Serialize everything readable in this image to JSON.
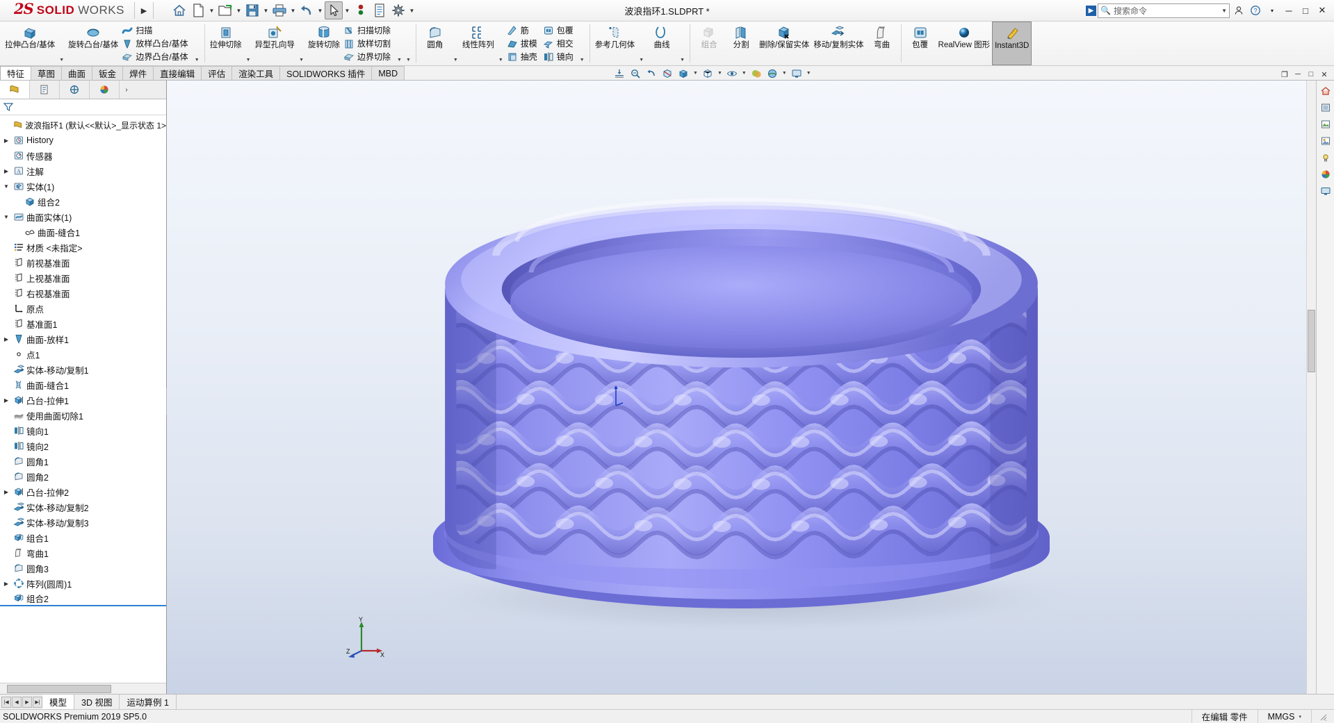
{
  "titlebar": {
    "brand_ds": "2S",
    "brand_solid": "SOLID",
    "brand_works": "WORKS",
    "expand_arrow": "▶",
    "document_title": "波浪指环1.SLDPRT *",
    "quick_access": [
      {
        "name": "home-icon",
        "label": "主页",
        "caret": false
      },
      {
        "name": "new-document-icon",
        "label": "新建",
        "caret": true
      },
      {
        "name": "open-folder-icon",
        "label": "打开",
        "caret": true
      },
      {
        "name": "save-icon",
        "label": "保存",
        "caret": true
      },
      {
        "name": "print-icon",
        "label": "打印",
        "caret": true
      },
      {
        "name": "undo-icon",
        "label": "撤销",
        "caret": true
      },
      {
        "name": "select-cursor-icon",
        "label": "选择",
        "caret": true
      },
      {
        "name": "rebuild-icon",
        "label": "重建模型",
        "caret": false
      },
      {
        "name": "file-properties-icon",
        "label": "文件属性",
        "caret": false
      },
      {
        "name": "options-gear-icon",
        "label": "选项",
        "caret": true
      }
    ],
    "search": {
      "placeholder": "搜索命令",
      "icon": "search-icon",
      "dropdown": "▼"
    },
    "help_icon": "help-icon",
    "account_icon": "account-icon",
    "help_caret": "▾",
    "window_buttons": {
      "minimize": "─",
      "maximize": "□",
      "close": "✕"
    }
  },
  "ribbon": {
    "groups": [
      {
        "id": "features-boss",
        "big": [
          {
            "name": "extruded-boss-base",
            "label": "拉伸凸台/基体",
            "icon": "extrude-boss-icon",
            "caret": true
          },
          {
            "name": "revolved-boss-base",
            "label": "旋转凸台/基体",
            "icon": "revolve-boss-icon",
            "caret": false
          }
        ],
        "small": [
          {
            "name": "swept-boss-base",
            "label": "扫描",
            "icon": "sweep-icon"
          },
          {
            "name": "lofted-boss-base",
            "label": "放样凸台/基体",
            "icon": "loft-icon"
          },
          {
            "name": "boundary-boss-base",
            "label": "边界凸台/基体",
            "icon": "boundary-icon"
          }
        ]
      },
      {
        "id": "features-cut",
        "big": [
          {
            "name": "extruded-cut",
            "label": "拉伸切除",
            "icon": "extrude-cut-icon",
            "caret": true
          },
          {
            "name": "hole-wizard",
            "label": "异型孔向导",
            "icon": "hole-wizard-icon",
            "caret": true
          },
          {
            "name": "revolved-cut",
            "label": "旋转切除",
            "icon": "revolve-cut-icon",
            "caret": false
          }
        ],
        "small": [
          {
            "name": "swept-cut",
            "label": "扫描切除",
            "icon": "sweep-cut-icon"
          },
          {
            "name": "lofted-cut",
            "label": "放样切割",
            "icon": "loft-cut-icon"
          },
          {
            "name": "boundary-cut",
            "label": "边界切除",
            "icon": "boundary-cut-icon"
          }
        ]
      },
      {
        "id": "features-modify",
        "big": [
          {
            "name": "fillet",
            "label": "圆角",
            "icon": "fillet-icon",
            "caret": true
          },
          {
            "name": "linear-pattern",
            "label": "线性阵列",
            "icon": "linear-pattern-icon",
            "caret": true
          }
        ],
        "small": [
          {
            "name": "rib",
            "label": "筋",
            "icon": "rib-icon"
          },
          {
            "name": "draft",
            "label": "拔模",
            "icon": "draft-icon"
          },
          {
            "name": "shell",
            "label": "抽壳",
            "icon": "shell-icon"
          }
        ],
        "small2": [
          {
            "name": "wrap",
            "label": "包覆",
            "icon": "wrap-icon"
          },
          {
            "name": "intersect",
            "label": "相交",
            "icon": "intersect-icon"
          },
          {
            "name": "mirror",
            "label": "镜向",
            "icon": "mirror-icon"
          }
        ]
      },
      {
        "id": "reference",
        "big": [
          {
            "name": "reference-geometry",
            "label": "参考几何体",
            "icon": "reference-geometry-icon",
            "caret": true
          },
          {
            "name": "curves",
            "label": "曲线",
            "icon": "curve-icon",
            "caret": true
          }
        ]
      },
      {
        "id": "bodies",
        "big": [
          {
            "name": "combine",
            "label": "组合",
            "icon": "combine-icon",
            "disabled": true
          },
          {
            "name": "split",
            "label": "分割",
            "icon": "split-icon"
          },
          {
            "name": "delete-keep-body",
            "label": "删除/保留实体",
            "icon": "delete-body-icon"
          },
          {
            "name": "move-copy-body",
            "label": "移动/复制实体",
            "icon": "move-copy-icon"
          },
          {
            "name": "flex",
            "label": "弯曲",
            "icon": "flex-icon"
          }
        ]
      },
      {
        "id": "display",
        "big": [
          {
            "name": "wrap-2",
            "label": "包覆",
            "icon": "wrap-icon"
          },
          {
            "name": "realview-graphics",
            "label": "RealView 图形",
            "icon": "realview-icon"
          },
          {
            "name": "instant3d",
            "label": "Instant3D",
            "icon": "instant3d-icon",
            "active": true
          }
        ]
      }
    ]
  },
  "command_tabs": {
    "items": [
      {
        "name": "tab-features",
        "label": "特征",
        "selected": true
      },
      {
        "name": "tab-sketch",
        "label": "草图",
        "selected": false
      },
      {
        "name": "tab-surfaces",
        "label": "曲面",
        "selected": false
      },
      {
        "name": "tab-sheetmetal",
        "label": "钣金",
        "selected": false
      },
      {
        "name": "tab-weldments",
        "label": "焊件",
        "selected": false
      },
      {
        "name": "tab-direct-editing",
        "label": "直接编辑",
        "selected": false
      },
      {
        "name": "tab-evaluate",
        "label": "评估",
        "selected": false
      },
      {
        "name": "tab-render-tools",
        "label": "渲染工具",
        "selected": false
      },
      {
        "name": "tab-sw-addins",
        "label": "SOLIDWORKS 插件",
        "selected": false
      },
      {
        "name": "tab-mbd",
        "label": "MBD",
        "selected": false
      }
    ],
    "window_controls": {
      "restore": "❐",
      "minimize": "─",
      "maximize": "□",
      "close": "✕"
    }
  },
  "heads_up_view": [
    {
      "name": "zoom-to-fit-icon",
      "label": "整屏显示全图",
      "caret": false
    },
    {
      "name": "zoom-to-area-icon",
      "label": "局部放大",
      "caret": false
    },
    {
      "name": "previous-view-icon",
      "label": "上一视图",
      "caret": false
    },
    {
      "name": "section-view-icon",
      "label": "剖面视图",
      "caret": false
    },
    {
      "name": "view-orientation-icon",
      "label": "视向",
      "caret": false
    },
    {
      "name": "display-style-icon",
      "label": "显示样式",
      "caret": true
    },
    {
      "name": "hide-show-items-icon",
      "label": "隐藏/显示项目",
      "caret": true
    },
    {
      "name": "edit-appearance-icon",
      "label": "编辑外观",
      "caret": false
    },
    {
      "name": "apply-scene-icon",
      "label": "应用布景",
      "caret": true
    },
    {
      "name": "view-settings-icon",
      "label": "视图设定",
      "caret": true
    }
  ],
  "feature_manager": {
    "tabs": [
      {
        "name": "featuremanager-design-tree-tab",
        "icon": "tree-icon",
        "selected": true
      },
      {
        "name": "property-manager-tab",
        "icon": "property-icon",
        "selected": false
      },
      {
        "name": "configuration-manager-tab",
        "icon": "config-icon",
        "selected": false
      },
      {
        "name": "display-manager-tab",
        "icon": "display-manager-icon",
        "selected": false
      }
    ],
    "more_tabs": "›",
    "filter_placeholder": "",
    "filter_value": "",
    "root": {
      "name": "tree-root-part",
      "icon": "part-icon",
      "label": "波浪指环1  (默认<<默认>_显示状态 1>"
    },
    "items": [
      {
        "name": "tree-item-history",
        "label": "History",
        "icon": "history-icon",
        "twist": "right",
        "indent": 0
      },
      {
        "name": "tree-item-sensors",
        "label": "传感器",
        "icon": "sensor-icon",
        "twist": "none",
        "indent": 0
      },
      {
        "name": "tree-item-annotations",
        "label": "注解",
        "icon": "annotation-icon",
        "twist": "right",
        "indent": 0
      },
      {
        "name": "tree-item-solid-bodies",
        "label": "实体(1)",
        "icon": "solid-bodies-icon",
        "twist": "down",
        "indent": 0
      },
      {
        "name": "tree-item-combine2-body",
        "label": "组合2",
        "icon": "body-cube-icon",
        "twist": "none",
        "indent": 1
      },
      {
        "name": "tree-item-surface-bodies",
        "label": "曲面实体(1)",
        "icon": "surface-bodies-icon",
        "twist": "down",
        "indent": 0
      },
      {
        "name": "tree-item-surface-knit1-body",
        "label": "曲面-缝合1",
        "icon": "surface-body-icon",
        "twist": "none",
        "indent": 1
      },
      {
        "name": "tree-item-material",
        "label": "材质 <未指定>",
        "icon": "material-icon",
        "twist": "none",
        "indent": 0
      },
      {
        "name": "tree-item-front-plane",
        "label": "前视基准面",
        "icon": "plane-icon",
        "twist": "none",
        "indent": 0
      },
      {
        "name": "tree-item-top-plane",
        "label": "上视基准面",
        "icon": "plane-icon",
        "twist": "none",
        "indent": 0
      },
      {
        "name": "tree-item-right-plane",
        "label": "右视基准面",
        "icon": "plane-icon",
        "twist": "none",
        "indent": 0
      },
      {
        "name": "tree-item-origin",
        "label": "原点",
        "icon": "origin-icon",
        "twist": "none",
        "indent": 0
      },
      {
        "name": "tree-item-plane1",
        "label": "基准面1",
        "icon": "plane-icon",
        "twist": "none",
        "indent": 0
      },
      {
        "name": "tree-item-surface-loft1",
        "label": "曲面-放样1",
        "icon": "surface-loft-icon",
        "twist": "right",
        "indent": 0
      },
      {
        "name": "tree-item-point1",
        "label": "点1",
        "icon": "point-icon",
        "twist": "none",
        "indent": 0
      },
      {
        "name": "tree-item-body-move-copy1",
        "label": "实体-移动/复制1",
        "icon": "move-copy-icon",
        "twist": "none",
        "indent": 0
      },
      {
        "name": "tree-item-surface-knit1",
        "label": "曲面-缝合1",
        "icon": "knit-icon",
        "twist": "none",
        "indent": 0
      },
      {
        "name": "tree-item-boss-extrude1",
        "label": "凸台-拉伸1",
        "icon": "boss-extrude-icon",
        "twist": "right",
        "indent": 0
      },
      {
        "name": "tree-item-cut-with-surface1",
        "label": "使用曲面切除1",
        "icon": "cut-surface-icon",
        "twist": "none",
        "indent": 0
      },
      {
        "name": "tree-item-mirror1",
        "label": "镜向1",
        "icon": "mirror-icon",
        "twist": "none",
        "indent": 0
      },
      {
        "name": "tree-item-mirror2",
        "label": "镜向2",
        "icon": "mirror-icon",
        "twist": "none",
        "indent": 0
      },
      {
        "name": "tree-item-fillet1",
        "label": "圆角1",
        "icon": "fillet-icon",
        "twist": "none",
        "indent": 0
      },
      {
        "name": "tree-item-fillet2",
        "label": "圆角2",
        "icon": "fillet-icon",
        "twist": "none",
        "indent": 0
      },
      {
        "name": "tree-item-boss-extrude2",
        "label": "凸台-拉伸2",
        "icon": "boss-extrude-icon",
        "twist": "right",
        "indent": 0
      },
      {
        "name": "tree-item-body-move-copy2",
        "label": "实体-移动/复制2",
        "icon": "move-copy-icon",
        "twist": "none",
        "indent": 0
      },
      {
        "name": "tree-item-body-move-copy3",
        "label": "实体-移动/复制3",
        "icon": "move-copy-icon",
        "twist": "none",
        "indent": 0
      },
      {
        "name": "tree-item-combine1",
        "label": "组合1",
        "icon": "combine-icon",
        "twist": "none",
        "indent": 0
      },
      {
        "name": "tree-item-flex1",
        "label": "弯曲1",
        "icon": "flex-icon",
        "twist": "none",
        "indent": 0
      },
      {
        "name": "tree-item-fillet3",
        "label": "圆角3",
        "icon": "fillet-icon",
        "twist": "none",
        "indent": 0
      },
      {
        "name": "tree-item-circular-pattern1",
        "label": "阵列(圆周)1",
        "icon": "circular-pattern-icon",
        "twist": "right",
        "indent": 0
      },
      {
        "name": "tree-item-combine2",
        "label": "组合2",
        "icon": "combine-icon",
        "twist": "none",
        "indent": 0,
        "rollback": true
      }
    ]
  },
  "right_toolbar": [
    {
      "name": "view-home-icon",
      "label": "视图主页"
    },
    {
      "name": "appearances-icon",
      "label": "外观"
    },
    {
      "name": "scenes-icon",
      "label": "布景"
    },
    {
      "name": "decals-icon",
      "label": "贴图"
    },
    {
      "name": "lights-cameras-icon",
      "label": "光源与相机"
    },
    {
      "name": "custom-appearance-icon",
      "label": "自定义外观"
    },
    {
      "name": "display-states-icon",
      "label": "显示状态"
    }
  ],
  "model_view": {
    "triad": {
      "x_label": "X",
      "y_label": "Y",
      "z_label": "Z"
    },
    "model_color": "#7b7ce8",
    "background_top": "#f2f5fb",
    "background_bottom": "#cfd8e8"
  },
  "bottom_tabs": {
    "nav": [
      "⏮",
      "◀",
      "▶",
      "⏭"
    ],
    "items": [
      {
        "name": "bottom-tab-model",
        "label": "模型",
        "selected": true
      },
      {
        "name": "bottom-tab-3dviews",
        "label": "3D 视图",
        "selected": false
      },
      {
        "name": "bottom-tab-motion-study",
        "label": "运动算例 1",
        "selected": false
      }
    ]
  },
  "status_bar": {
    "left": "SOLIDWORKS Premium 2019 SP5.0",
    "editing": "在编辑 零件",
    "units": "MMGS",
    "units_caret": "▾"
  }
}
